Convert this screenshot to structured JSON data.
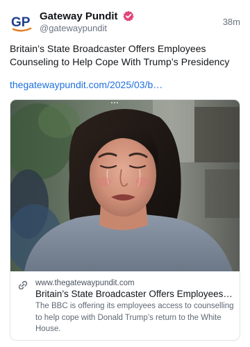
{
  "author": {
    "avatar_text": "GP",
    "name": "Gateway Pundit",
    "handle": "@gatewaypundit",
    "verified_icon": "verified-badge-icon",
    "verified_color": "#e0457b"
  },
  "post": {
    "time": "38m",
    "text": "Britain’s State Broadcaster Offers Employees Counseling to Help Cope With Trump’s Presidency",
    "link_text": "thegatewaypundit.com/2025/03/b…",
    "link_color": "#1d6fde"
  },
  "card": {
    "image_alt_icon": "crying-woman-photo",
    "link_icon": "link-icon",
    "domain": "www.thegatewaypundit.com",
    "title": "Britain’s State Broadcaster Offers Employees Counseling to Help Cope With Trump’s Presidency",
    "description": "The BBC is offering its employees access to counselling to help cope with Donald Trump’s return to the White House."
  }
}
